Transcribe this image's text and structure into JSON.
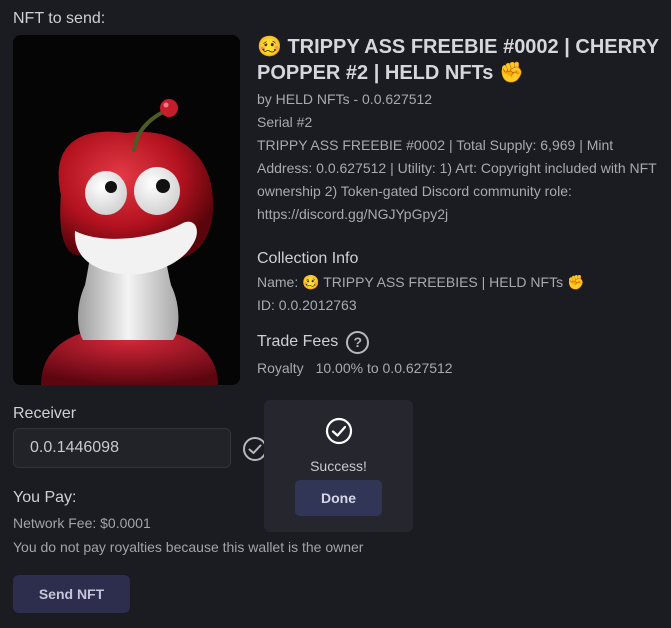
{
  "header": {
    "title": "NFT to send:"
  },
  "nft": {
    "image_alt": "Cartoon cherry character",
    "title": "🥴 TRIPPY ASS FREEBIE #0002 | CHERRY POPPER #2 | HELD NFTs ✊",
    "by": "by HELD NFTs - 0.0.627512",
    "serial": "Serial #2",
    "description": "TRIPPY ASS FREEBIE #0002 | Total Supply: 6,969 | Mint Address: 0.0.627512 | Utility: 1) Art: Copyright included with NFT ownership 2) Token-gated Discord community role: https://discord.gg/NGJYpGpy2j"
  },
  "collection": {
    "heading": "Collection Info",
    "name": "Name: 🥴 TRIPPY ASS FREEBIES | HELD NFTs ✊",
    "id": "ID: 0.0.2012763"
  },
  "trade_fees": {
    "heading": "Trade Fees",
    "help_icon": "question-circle-icon",
    "royalty_label": "Royalty",
    "royalty_value": "10.00% to 0.0.627512"
  },
  "receiver": {
    "label": "Receiver",
    "value": "0.0.1446098",
    "valid_icon": "check-circle-icon"
  },
  "payment": {
    "heading": "You Pay:",
    "network_fee": "Network Fee: $0.0001",
    "royalty_note": "You do not pay royalties because this wallet is the owner"
  },
  "send_button": {
    "label": "Send NFT"
  },
  "modal": {
    "icon": "check-circle-icon",
    "message": "Success!",
    "done_label": "Done"
  },
  "colors": {
    "background": "#1b1b22",
    "button": "#2d2d4d",
    "modal": "#26262e"
  }
}
